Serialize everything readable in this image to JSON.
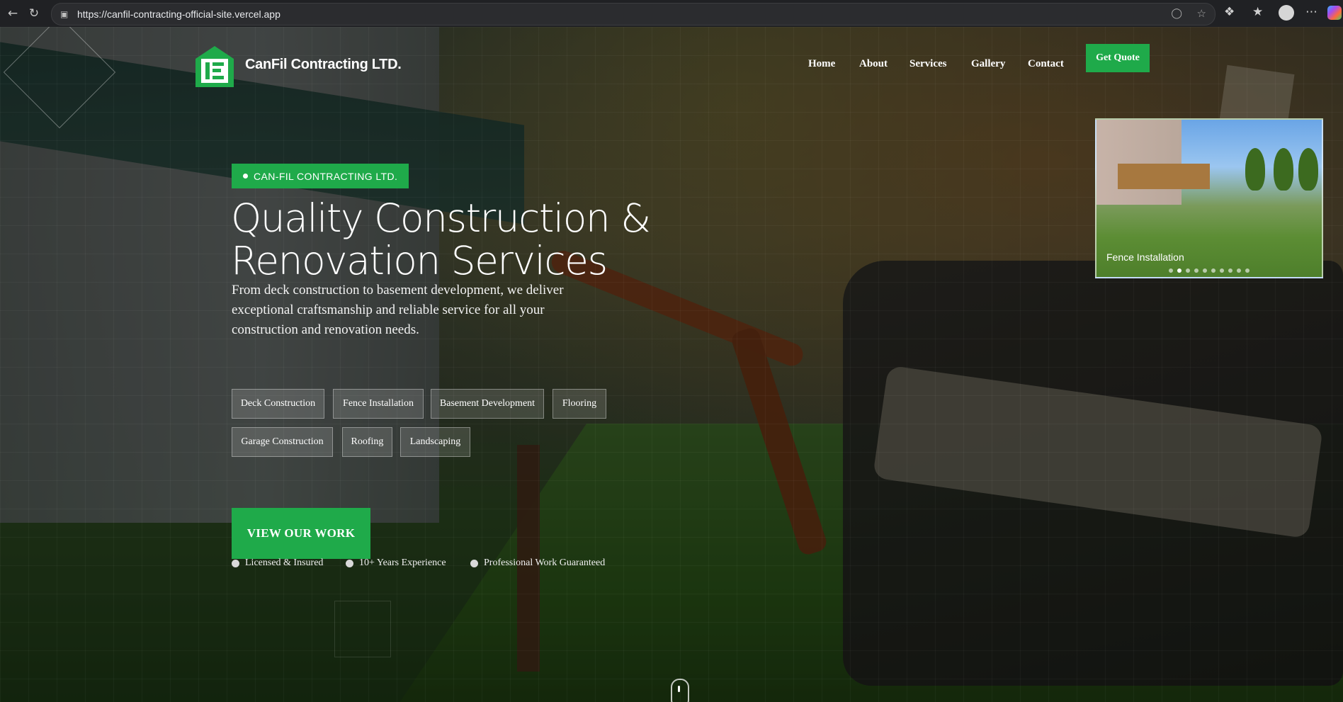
{
  "browser": {
    "url": "https://canfil-contracting-official-site.vercel.app"
  },
  "nav": {
    "brand": "CanFil Contracting LTD.",
    "links": [
      "Home",
      "About",
      "Services",
      "Gallery",
      "Contact"
    ],
    "cta": "Get Quote"
  },
  "hero": {
    "tag": "CAN-FIL CONTRACTING LTD.",
    "title_line1": "Quality Construction &",
    "title_line2": "Renovation Services",
    "description": "From deck construction to basement development, we deliver exceptional craftsmanship and reliable service for all your construction and renovation needs.",
    "services": [
      "Deck Construction",
      "Fence Installation",
      "Basement Development",
      "Flooring",
      "Garage Construction",
      "Roofing",
      "Landscaping"
    ],
    "cta": "VIEW OUR WORK",
    "features": [
      "Licensed & Insured",
      "10+ Years Experience",
      "Professional Work Guaranteed"
    ]
  },
  "gallery": {
    "caption": "Fence Installation",
    "slide_count": 10,
    "active_slide": 2
  },
  "colors": {
    "accent": "#1faa4a",
    "chrome_bg": "#202124"
  }
}
